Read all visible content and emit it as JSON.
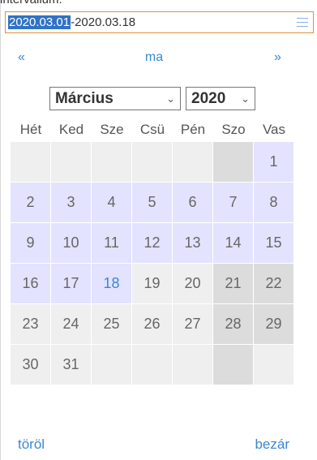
{
  "background_label": "intervallum:",
  "input": {
    "selected_part": "2020.03.01",
    "rest_part": "-2020.03.18",
    "menu_icon": "menu-icon"
  },
  "nav": {
    "prev": "«",
    "today": "ma",
    "next": "»"
  },
  "selects": {
    "month": "Március",
    "year": "2020"
  },
  "weekdays": [
    "Hét",
    "Ked",
    "Sze",
    "Csü",
    "Pén",
    "Szo",
    "Vas"
  ],
  "weeks": [
    [
      "",
      "",
      "",
      "",
      "",
      "",
      "1"
    ],
    [
      "2",
      "3",
      "4",
      "5",
      "6",
      "7",
      "8"
    ],
    [
      "9",
      "10",
      "11",
      "12",
      "13",
      "14",
      "15"
    ],
    [
      "16",
      "17",
      "18",
      "19",
      "20",
      "21",
      "22"
    ],
    [
      "23",
      "24",
      "25",
      "26",
      "27",
      "28",
      "29"
    ],
    [
      "30",
      "31",
      "",
      "",
      "",
      "",
      ""
    ]
  ],
  "footer": {
    "clear": "töröl",
    "close": "bezár"
  },
  "colors": {
    "accent": "#3a87d1",
    "range": "#e3e3ff",
    "weekend": "#dcdcdc",
    "border": "#e0913f"
  }
}
